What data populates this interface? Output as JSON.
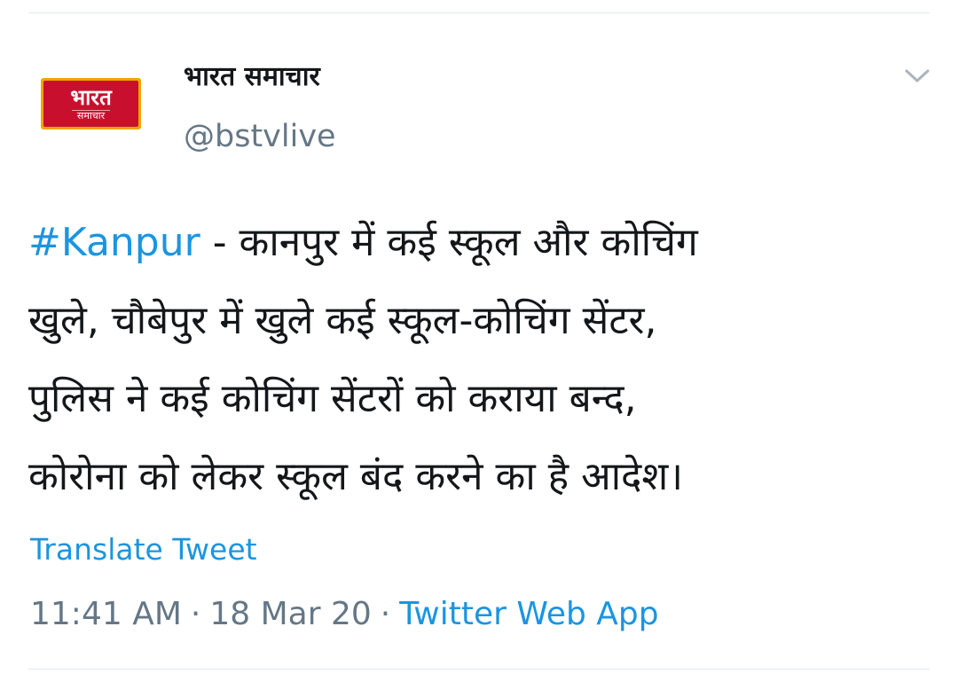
{
  "tweet": {
    "author": {
      "avatar_text": "भारत",
      "avatar_subtext": "समाचार",
      "display_name": "भारत समाचार",
      "handle": "@bstvlive"
    },
    "menu_icon": "chevron-down-icon",
    "hashtag": "#Kanpur",
    "text_lines": [
      " - कानपुर में कई स्कूल और कोचिंग",
      "खुले, चौबेपुर में खुले कई स्कूल-कोचिंग सेंटर,",
      "पुलिस ने कई कोचिंग सेंटरों को कराया बन्द,",
      "कोरोना को लेकर स्कूल बंद करने का है आदेश।"
    ],
    "translate_label": "Translate Tweet",
    "time": "11:41 AM",
    "date": "18 Mar 20",
    "separator": "·",
    "source": "Twitter Web App"
  },
  "colors": {
    "link": "#1b95e0",
    "secondary_text": "#657786",
    "primary_text": "#14171a",
    "divider": "#e1e8ed",
    "avatar_red": "#c8102e",
    "avatar_gold": "#f0a400"
  }
}
